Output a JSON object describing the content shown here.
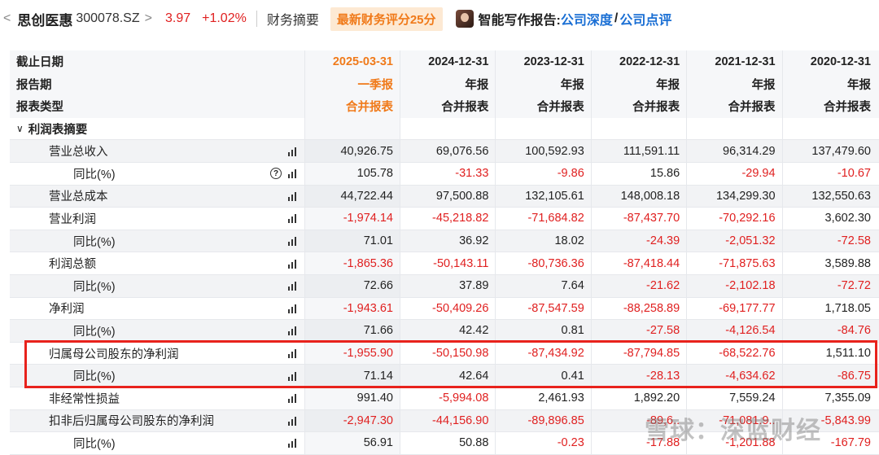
{
  "header": {
    "back": "<",
    "name": "思创医惠",
    "code": "300078.SZ",
    "chev": ">",
    "price": "3.97",
    "change": "+1.02%",
    "tab": "财务摘要",
    "badge": "最新财务评分25分",
    "ai_label": "智能写作报告:",
    "link1": "公司深度",
    "slash": "/",
    "link2": "公司点评"
  },
  "table": {
    "hdr": [
      [
        "截止日期",
        "2025-03-31",
        "2024-12-31",
        "2023-12-31",
        "2022-12-31",
        "2021-12-31",
        "2020-12-31"
      ],
      [
        "报告期",
        "一季报",
        "年报",
        "年报",
        "年报",
        "年报",
        "年报"
      ],
      [
        "报表类型",
        "合并报表",
        "合并报表",
        "合并报表",
        "合并报表",
        "合并报表",
        "合并报表"
      ]
    ],
    "section": "利润表摘要",
    "rows": [
      [
        "营业总收入",
        "40,926.75",
        "69,076.56",
        "100,592.93",
        "111,591.11",
        "96,314.29",
        "137,479.60"
      ],
      [
        "同比(%)",
        "105.78",
        "-31.33",
        "-9.86",
        "15.86",
        "-29.94",
        "-10.67"
      ],
      [
        "营业总成本",
        "44,722.44",
        "97,500.88",
        "132,105.61",
        "148,008.18",
        "134,299.30",
        "132,550.63"
      ],
      [
        "营业利润",
        "-1,974.14",
        "-45,218.82",
        "-71,684.82",
        "-87,437.70",
        "-70,292.16",
        "3,602.30"
      ],
      [
        "同比(%)",
        "71.01",
        "36.92",
        "18.02",
        "-24.39",
        "-2,051.32",
        "-72.58"
      ],
      [
        "利润总额",
        "-1,865.36",
        "-50,143.11",
        "-80,736.36",
        "-87,418.44",
        "-71,875.63",
        "3,589.88"
      ],
      [
        "同比(%)",
        "72.66",
        "37.89",
        "7.64",
        "-21.62",
        "-2,102.18",
        "-72.72"
      ],
      [
        "净利润",
        "-1,943.61",
        "-50,409.26",
        "-87,547.59",
        "-88,258.89",
        "-69,177.77",
        "1,718.05"
      ],
      [
        "同比(%)",
        "71.66",
        "42.42",
        "0.81",
        "-27.58",
        "-4,126.54",
        "-84.76"
      ],
      [
        "归属母公司股东的净利润",
        "-1,955.90",
        "-50,150.98",
        "-87,434.92",
        "-87,794.85",
        "-68,522.76",
        "1,511.10"
      ],
      [
        "同比(%)",
        "71.14",
        "42.64",
        "0.41",
        "-28.13",
        "-4,634.62",
        "-86.75"
      ],
      [
        "非经常性损益",
        "991.40",
        "-5,994.08",
        "2,461.93",
        "1,892.20",
        "7,559.24",
        "7,355.09"
      ],
      [
        "扣非后归属母公司股东的净利润",
        "-2,947.30",
        "-44,156.90",
        "-89,896.85",
        "-89,6..",
        "-71,081.9..",
        "-5,843.99"
      ],
      [
        "同比(%)",
        "56.91",
        "50.88",
        "-0.23",
        "-17.88",
        "-1,201.88",
        "-167.79"
      ]
    ]
  },
  "watermark": "雪球：深蓝财经",
  "colors": {
    "negative": "#e02020",
    "accent": "#f07a1a",
    "link": "#1a6fd4",
    "highlight": "#e8221c"
  }
}
